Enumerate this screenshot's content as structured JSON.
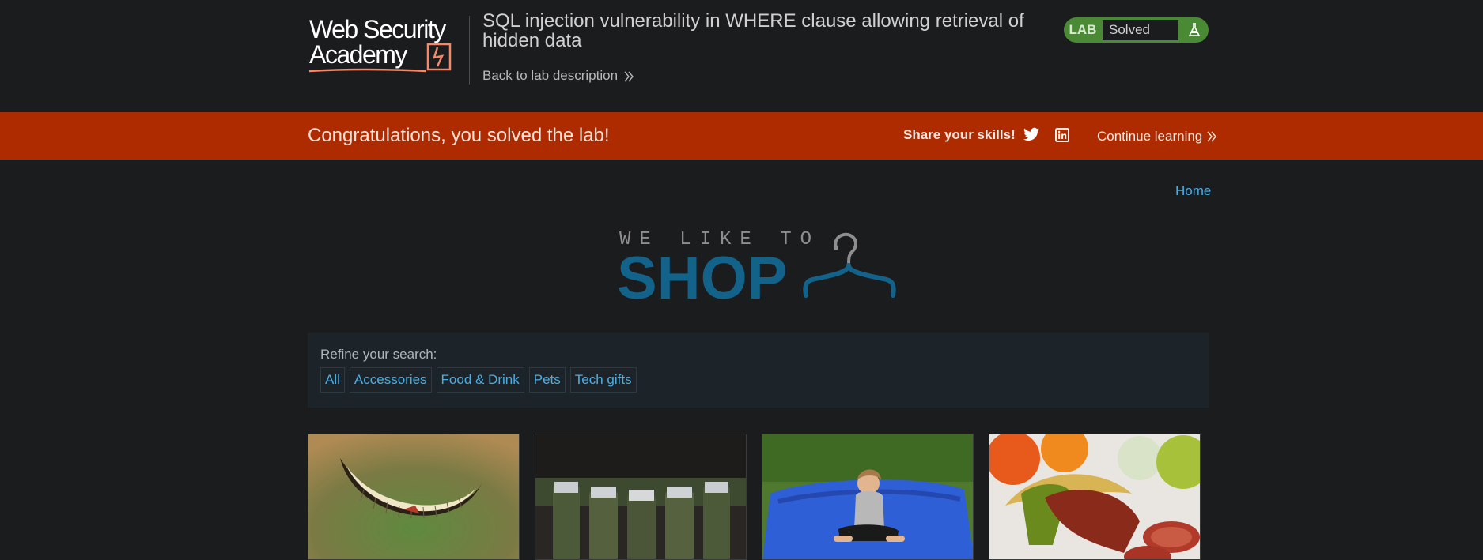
{
  "header": {
    "logo_line1": "Web Security",
    "logo_line2": "Academy",
    "lab_title": "SQL injection vulnerability in WHERE clause allowing retrieval of hidden data",
    "back_link": "Back to lab description",
    "status_lab": "LAB",
    "status_value": "Solved",
    "flask_icon": "flask-icon"
  },
  "banner": {
    "message": "Congratulations, you solved the lab!",
    "share_label": "Share your skills!",
    "twitter_icon": "twitter-icon",
    "linkedin_icon": "linkedin-icon",
    "continue_label": "Continue learning"
  },
  "nav": {
    "home": "Home"
  },
  "shop_logo": {
    "tagline": "WE LIKE TO",
    "word": "SHOP"
  },
  "filter": {
    "label": "Refine your search:",
    "categories": [
      "All",
      "Accessories",
      "Food & Drink",
      "Pets",
      "Tech gifts"
    ]
  },
  "colors": {
    "banner": "#ae2b00",
    "link": "#4aaee5",
    "status": "#4a8a34",
    "shop_blue": "#13628a"
  },
  "products": [
    {
      "image": "cheshire-grin-image"
    },
    {
      "image": "beer-belt-image"
    },
    {
      "image": "blue-beanbag-image"
    },
    {
      "image": "sausage-fruit-image"
    }
  ]
}
